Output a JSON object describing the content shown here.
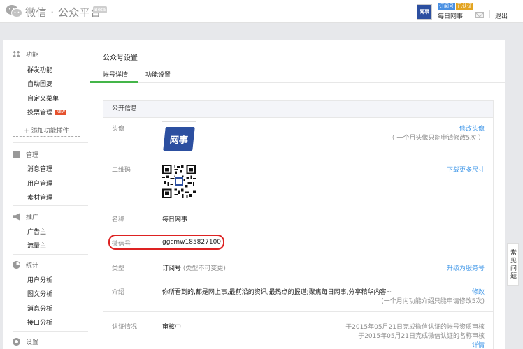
{
  "header": {
    "logo_text": "微信 · 公众平台",
    "beta": "Beta",
    "account_tag_type": "订阅号",
    "account_tag_verified": "已认证",
    "account_name": "每日网事",
    "avatar_text": "网事",
    "logout": "退出"
  },
  "sidebar": {
    "groups": [
      {
        "label": "功能",
        "icon": "grid-icon",
        "items": [
          "群发功能",
          "自动回复",
          "自定义菜单",
          "投票管理"
        ]
      },
      {
        "label": "管理",
        "icon": "box-icon",
        "items": [
          "消息管理",
          "用户管理",
          "素材管理"
        ]
      },
      {
        "label": "推广",
        "icon": "speaker-icon",
        "items": [
          "广告主",
          "流量主"
        ]
      },
      {
        "label": "统计",
        "icon": "pie-icon",
        "items": [
          "用户分析",
          "图文分析",
          "消息分析",
          "接口分析"
        ]
      },
      {
        "label": "设置",
        "icon": "gear-icon",
        "items": []
      }
    ],
    "new_badge": "NEW",
    "add_plugin": "+ 添加功能插件"
  },
  "main": {
    "title": "公众号设置",
    "tabs": [
      "帐号详情",
      "功能设置"
    ],
    "section": "公开信息",
    "rows": {
      "avatar": {
        "label": "头像",
        "link": "修改头像",
        "note": "（ 一个月头像只能申请修改5次 ）",
        "text": "网事"
      },
      "qrcode": {
        "label": "二维码",
        "link": "下载更多尺寸"
      },
      "name": {
        "label": "名称",
        "value": "每日网事"
      },
      "wechat_id": {
        "label": "微信号",
        "value": "ggcmw185827100"
      },
      "type": {
        "label": "类型",
        "value": "订阅号",
        "value_note": "(类型不可变更)",
        "link": "升级为服务号"
      },
      "intro": {
        "label": "介绍",
        "value": "你所看到的,都是网上事,最前沿的资讯,最热点的报道;聚焦每日网事,分享精华内容~",
        "link": "修改",
        "note": "(一个月内功能介绍只能申请修改5次)"
      },
      "verify": {
        "label": "认证情况",
        "value": "审核中",
        "note1": "于2015年05月21日完成微信认证的帐号资质审核",
        "note2": "于2015年05月21日完成微信认证的名称审核",
        "link": "详情"
      }
    }
  },
  "faq": "常见问题",
  "colors": {
    "accent_green": "#44b549",
    "link_blue": "#459ae9",
    "highlight_red": "#dd2222",
    "brand_blue": "#2c4fa0"
  }
}
